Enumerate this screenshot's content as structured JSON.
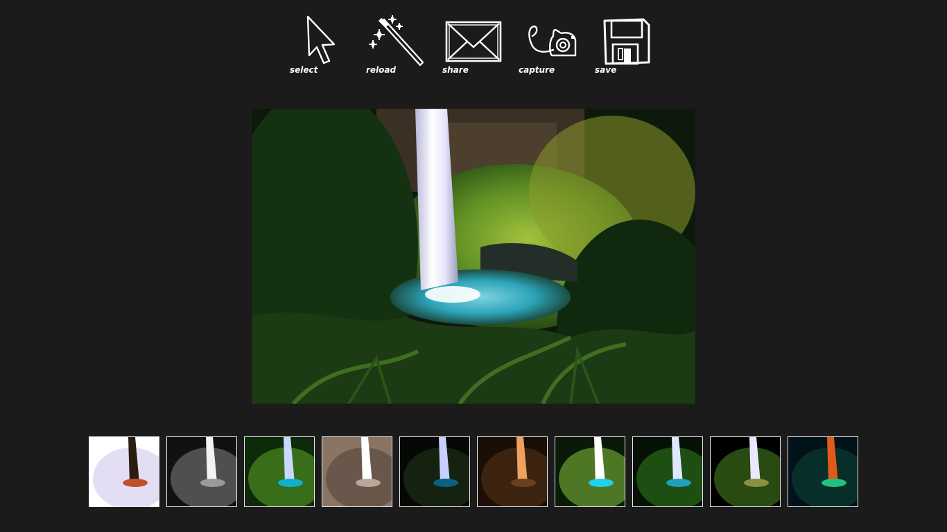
{
  "toolbar": {
    "items": [
      {
        "label": "select",
        "icon": "cursor-arrow-icon"
      },
      {
        "label": "reload",
        "icon": "magic-wand-icon"
      },
      {
        "label": "share",
        "icon": "envelope-icon"
      },
      {
        "label": "capture",
        "icon": "camera-icon"
      },
      {
        "label": "save",
        "icon": "floppy-disk-icon"
      }
    ]
  },
  "main_image": {
    "subject": "waterfall in forest"
  },
  "filters": {
    "thumbnails": [
      {
        "effect": "inverted",
        "colors": [
          "#ffffff",
          "#d8d0f0",
          "#2a1c10",
          "#c0502a"
        ]
      },
      {
        "effect": "grayscale",
        "colors": [
          "#111111",
          "#6a6a6a",
          "#f2f2f2",
          "#9a9a9a"
        ]
      },
      {
        "effect": "vivid",
        "colors": [
          "#0e2a0a",
          "#4a8a20",
          "#c8d8ff",
          "#10b0d0"
        ]
      },
      {
        "effect": "sepia",
        "colors": [
          "#8a7565",
          "#5a4a3e",
          "#ffffff",
          "#b8a898"
        ]
      },
      {
        "effect": "dark",
        "colors": [
          "#050805",
          "#1c2e16",
          "#c8d0ff",
          "#0a6080"
        ]
      },
      {
        "effect": "warm",
        "colors": [
          "#1a0e06",
          "#4a2c14",
          "#f0a060",
          "#6a4020"
        ]
      },
      {
        "effect": "bright",
        "colors": [
          "#0a1a08",
          "#6aa030",
          "#ffffff",
          "#20d0f0"
        ]
      },
      {
        "effect": "green",
        "colors": [
          "#061206",
          "#2a6a18",
          "#e0e8ff",
          "#20a0c0"
        ]
      },
      {
        "effect": "posterize",
        "colors": [
          "#000000",
          "#3a6a18",
          "#e8e8ff",
          "#8a9040"
        ]
      },
      {
        "effect": "color-swap",
        "colors": [
          "#02121a",
          "#0a3a30",
          "#e05a1a",
          "#20c080"
        ]
      }
    ]
  }
}
